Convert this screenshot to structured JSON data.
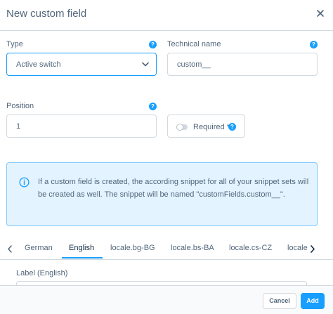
{
  "modal": {
    "title": "New custom field"
  },
  "type": {
    "label": "Type",
    "value": "Active switch",
    "help": "?"
  },
  "technical_name": {
    "label": "Technical name",
    "value": "custom__",
    "help": "?"
  },
  "position": {
    "label": "Position",
    "value": "1",
    "help": "?"
  },
  "required": {
    "label": "Required *",
    "help": "?",
    "checked": false
  },
  "info": {
    "text": "If a custom field is created, the according snippet for all of your snippet sets will be created as well. The snippet will be named \"customFields.custom__\"."
  },
  "tabs": {
    "items": [
      {
        "label": "German"
      },
      {
        "label": "English"
      },
      {
        "label": "locale.bg-BG"
      },
      {
        "label": "locale.bs-BA"
      },
      {
        "label": "locale.cs-CZ"
      },
      {
        "label": "locale.da-DK"
      }
    ],
    "active": "English"
  },
  "label_field": {
    "label": "Label (English)"
  },
  "footer": {
    "cancel": "Cancel",
    "add": "Add"
  },
  "colors": {
    "accent": "#189eff",
    "text": "#52667a",
    "info_bg": "#e3f3ff",
    "border": "#d1d9e0"
  }
}
